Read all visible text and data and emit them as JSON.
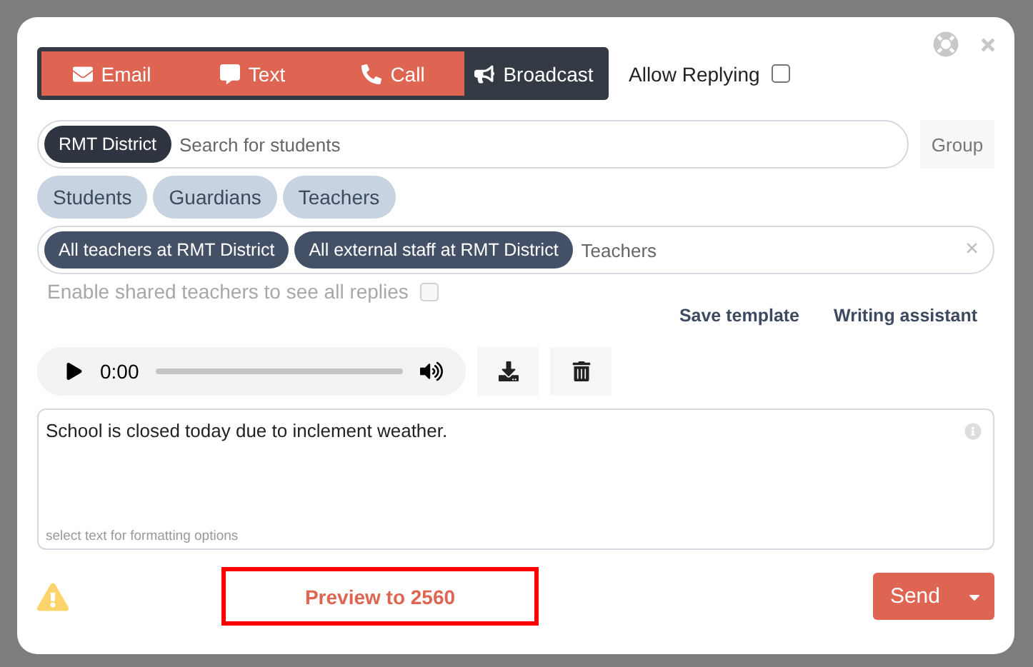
{
  "mode_tabs": [
    {
      "label": "Email",
      "kind": "email",
      "selected": false
    },
    {
      "label": "Text",
      "kind": "text",
      "selected": false
    },
    {
      "label": "Call",
      "kind": "call",
      "selected": false
    },
    {
      "label": "Broadcast",
      "kind": "broadcast",
      "selected": true
    }
  ],
  "allow_replying": {
    "label": "Allow Replying",
    "checked": false
  },
  "student_search": {
    "chip": "RMT District",
    "placeholder": "Search for students",
    "group_button": "Group"
  },
  "recipient_types": [
    {
      "label": "Students"
    },
    {
      "label": "Guardians"
    },
    {
      "label": "Teachers"
    }
  ],
  "recipients": {
    "chips": [
      "All teachers at RMT District",
      "All external staff at RMT District"
    ],
    "placeholder": "Teachers",
    "clear": "×"
  },
  "shared_teachers": {
    "label": "Enable shared teachers to see all replies",
    "checked": false,
    "disabled": true
  },
  "links": [
    "Save template",
    "Writing assistant"
  ],
  "audio": {
    "time": "0:00",
    "level": 0
  },
  "message": {
    "value": "School is closed today due to inclement weather.",
    "hint": "select text for formatting options"
  },
  "footer": {
    "preview": "Preview to 2560",
    "send": "Send"
  }
}
